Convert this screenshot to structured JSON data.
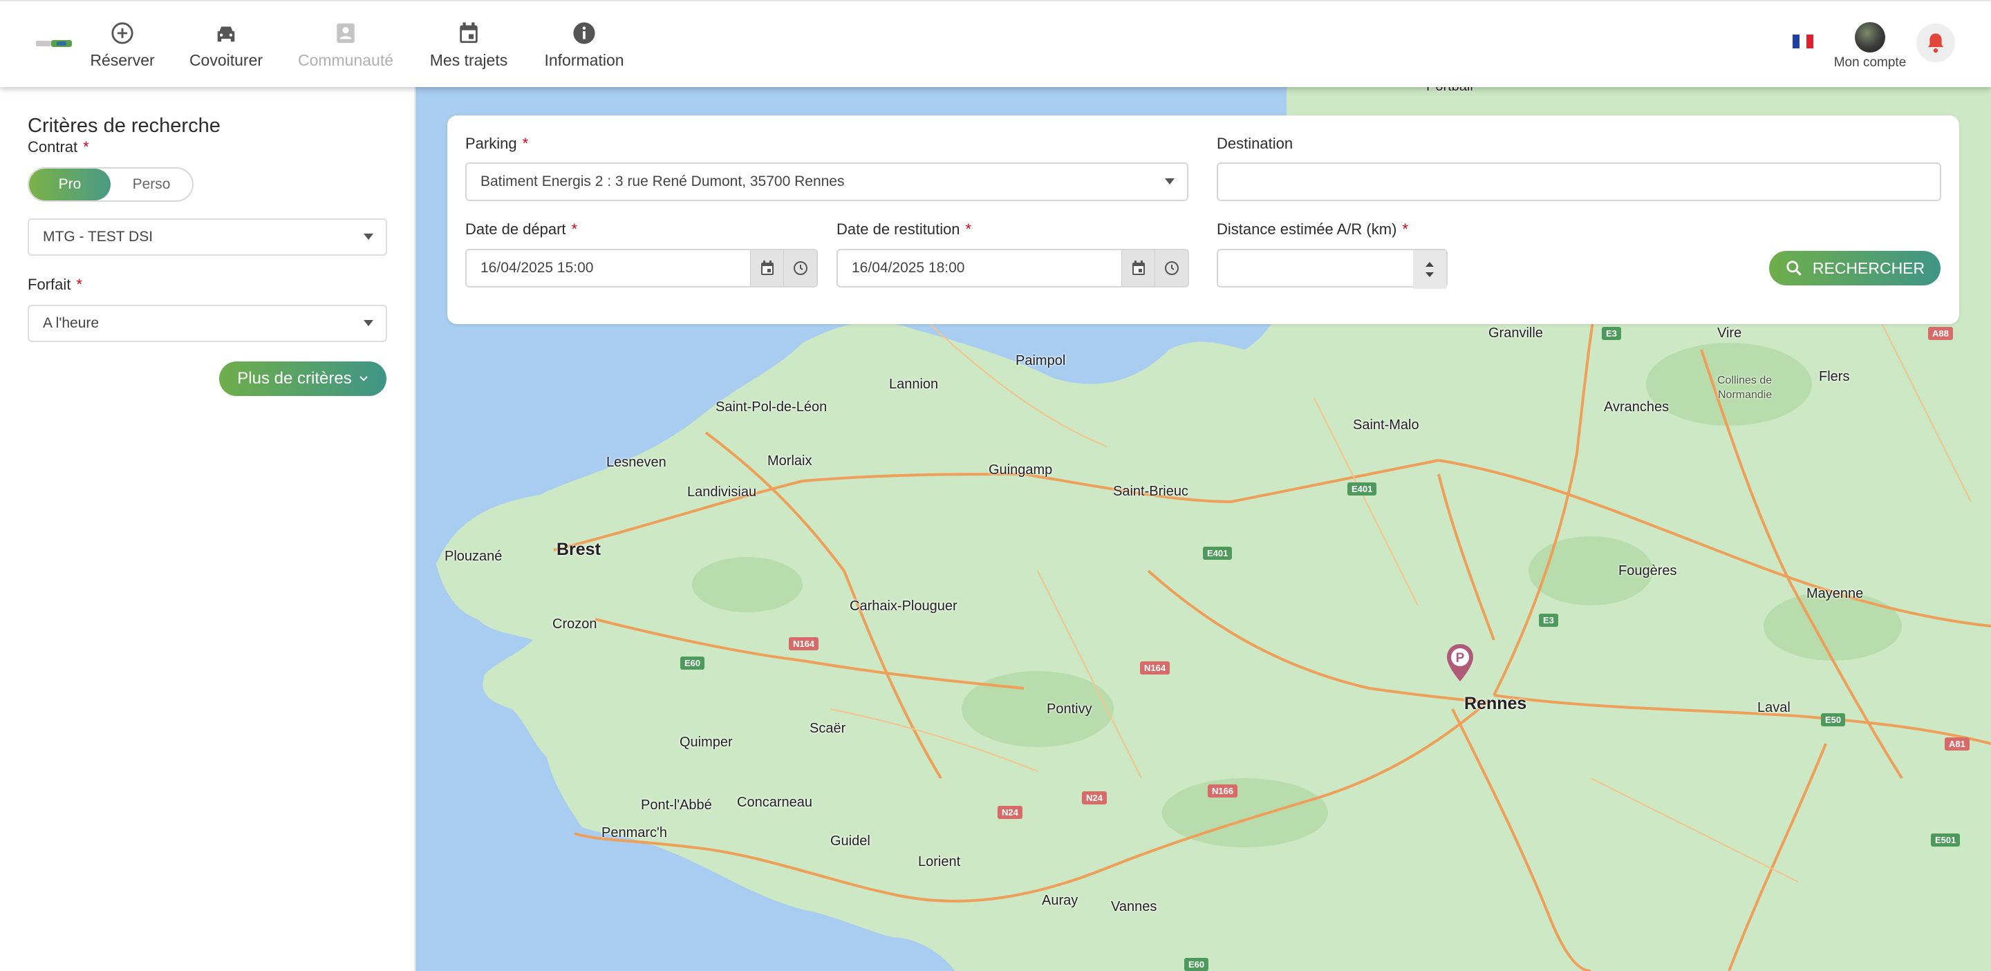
{
  "nav": {
    "items": [
      {
        "label": "Réserver",
        "icon": "plus-circle-icon"
      },
      {
        "label": "Covoiturer",
        "icon": "car-icon"
      },
      {
        "label": "Communauté",
        "icon": "community-badge-icon",
        "disabled": true
      },
      {
        "label": "Mes trajets",
        "icon": "calendar-icon"
      },
      {
        "label": "Information",
        "icon": "info-icon"
      }
    ],
    "account_label": "Mon compte",
    "language": "FR"
  },
  "sidebar": {
    "title": "Critères de recherche",
    "contract": {
      "label": "Contrat",
      "options": [
        "Pro",
        "Perso"
      ],
      "selected": "Pro"
    },
    "contract_select": "MTG - TEST DSI",
    "forfait": {
      "label": "Forfait",
      "value": "A l'heure"
    },
    "more_button": "Plus de critères"
  },
  "search": {
    "parking": {
      "label": "Parking",
      "value": "Batiment Energis 2 : 3 rue René Dumont, 35700 Rennes"
    },
    "destination": {
      "label": "Destination",
      "value": ""
    },
    "departure": {
      "label": "Date de départ",
      "value": "16/04/2025 15:00"
    },
    "return": {
      "label": "Date de restitution",
      "value": "16/04/2025 18:00"
    },
    "distance": {
      "label": "Distance estimée A/R (km)",
      "value": ""
    },
    "search_button": "RECHERCHER"
  },
  "map": {
    "cities": [
      {
        "name": "Portbail"
      },
      {
        "name": "Granville"
      },
      {
        "name": "Vire"
      },
      {
        "name": "Flers"
      },
      {
        "name": "Collines de"
      },
      {
        "name": "Normandie"
      },
      {
        "name": "Paimpol"
      },
      {
        "name": "Lannion"
      },
      {
        "name": "Saint-Pol-de-Léon"
      },
      {
        "name": "Avranches"
      },
      {
        "name": "Saint-Malo"
      },
      {
        "name": "Lesneven"
      },
      {
        "name": "Morlaix"
      },
      {
        "name": "Guingamp"
      },
      {
        "name": "Landivisiau"
      },
      {
        "name": "Saint-Brieuc"
      },
      {
        "name": "Brest"
      },
      {
        "name": "Plouzané"
      },
      {
        "name": "Fougères"
      },
      {
        "name": "Mayenne"
      },
      {
        "name": "Carhaix-Plouguer"
      },
      {
        "name": "Crozon"
      },
      {
        "name": "Rennes"
      },
      {
        "name": "Pontivy"
      },
      {
        "name": "Laval"
      },
      {
        "name": "Scaër"
      },
      {
        "name": "Quimper"
      },
      {
        "name": "Pont-l'Abbé"
      },
      {
        "name": "Concarneau"
      },
      {
        "name": "Penmarc'h"
      },
      {
        "name": "Guidel"
      },
      {
        "name": "Lorient"
      },
      {
        "name": "Auray"
      },
      {
        "name": "Vannes"
      }
    ],
    "road_shields": [
      {
        "label": "E3",
        "color": "green"
      },
      {
        "label": "A88",
        "color": "red"
      },
      {
        "label": "E401",
        "color": "green"
      },
      {
        "label": "E401",
        "color": "green"
      },
      {
        "label": "E3",
        "color": "green"
      },
      {
        "label": "N164",
        "color": "red"
      },
      {
        "label": "E60",
        "color": "green"
      },
      {
        "label": "N164",
        "color": "red"
      },
      {
        "label": "N24",
        "color": "red"
      },
      {
        "label": "N24",
        "color": "red"
      },
      {
        "label": "N166",
        "color": "red"
      },
      {
        "label": "E50",
        "color": "green"
      },
      {
        "label": "A81",
        "color": "red"
      },
      {
        "label": "E501",
        "color": "green"
      },
      {
        "label": "E60",
        "color": "green"
      }
    ],
    "parking_marker": "P"
  },
  "colors": {
    "accent_start": "#7bb247",
    "accent_end": "#3f9587",
    "required": "#d0021b",
    "sea": "#a8cdf0",
    "land": "#cde8c4"
  }
}
